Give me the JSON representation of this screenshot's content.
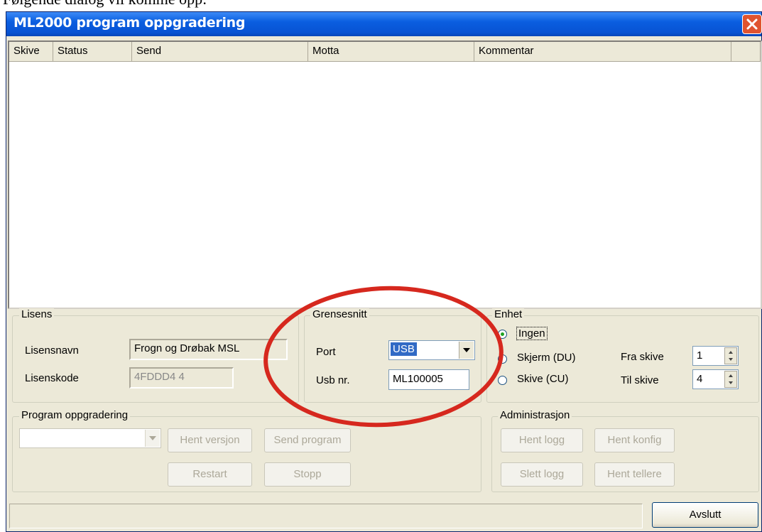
{
  "caption": "Følgende dialog vil komme opp:",
  "window": {
    "title": "ML2000 program oppgradering",
    "close_icon": "close-icon"
  },
  "list": {
    "columns": [
      "Skive",
      "Status",
      "Send",
      "Motta",
      "Kommentar"
    ]
  },
  "lisens": {
    "title": "Lisens",
    "name_label": "Lisensnavn",
    "name_value": "Frogn og Drøbak MSL",
    "code_label": "Lisenskode",
    "code_value": "4FDDD4 4"
  },
  "grensesnitt": {
    "title": "Grensesnitt",
    "port_label": "Port",
    "port_value": "USB",
    "usb_label": "Usb nr.",
    "usb_value": "ML100005"
  },
  "enhet": {
    "title": "Enhet",
    "options": [
      "Ingen",
      "Skjerm (DU)",
      "Skive (CU)"
    ],
    "selected": "Ingen",
    "fra_label": "Fra skive",
    "fra_value": "1",
    "til_label": "Til skive",
    "til_value": "4"
  },
  "program": {
    "title": "Program oppgradering",
    "hent_versjon": "Hent versjon",
    "send_program": "Send program",
    "restart": "Restart",
    "stopp": "Stopp"
  },
  "admin": {
    "title": "Administrasjon",
    "hent_logg": "Hent logg",
    "hent_konfig": "Hent konfig",
    "slett_logg": "Slett logg",
    "hent_tellere": "Hent tellere"
  },
  "footer": {
    "avslutt": "Avslutt"
  },
  "annotation": {
    "color": "#d6281e"
  }
}
